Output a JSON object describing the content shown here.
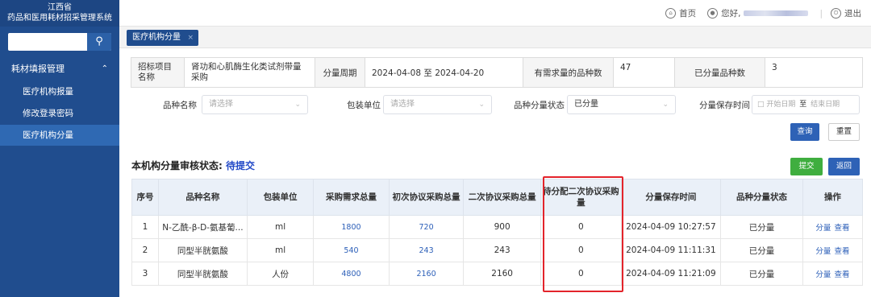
{
  "sidebar": {
    "logo_line1": "江西省",
    "logo_line2": "药品和医用耗材招采管理系统",
    "search_icon": "search-icon",
    "group_label": "耗材填报管理",
    "items": [
      {
        "label": "医疗机构报量"
      },
      {
        "label": "修改登录密码"
      },
      {
        "label": "医疗机构分量"
      }
    ]
  },
  "topbar": {
    "home": "首页",
    "greeting": "您好,",
    "logout": "退出"
  },
  "tab": {
    "label": "医疗机构分量",
    "close": "×"
  },
  "info": {
    "project_label": "招标项目名称",
    "project_value": "肾功和心肌酶生化类试剂带量采购",
    "period_label": "分量周期",
    "period_value": "2024-04-08 至 2024-04-20",
    "demand_count_label": "有需求量的品种数",
    "demand_count_value": "47",
    "allocated_count_label": "已分量品种数",
    "allocated_count_value": "3"
  },
  "filters": {
    "variety_label": "品种名称",
    "variety_placeholder": "请选择",
    "unit_label": "包装单位",
    "unit_placeholder": "请选择",
    "status_label": "品种分量状态",
    "status_value": "已分量",
    "save_time_label": "分量保存时间",
    "start_placeholder": "开始日期",
    "range_sep": "至",
    "end_placeholder": "结束日期"
  },
  "buttons": {
    "query": "查询",
    "reset": "重置",
    "submit": "提交",
    "back": "返回"
  },
  "status": {
    "prefix": "本机构分量审核状态:",
    "value": "待提交"
  },
  "table": {
    "headers": [
      "序号",
      "品种名称",
      "包装单位",
      "采购需求总量",
      "初次协议采购总量",
      "二次协议采购总量",
      "待分配二次协议采购量",
      "分量保存时间",
      "品种分量状态",
      "操作"
    ],
    "rows": [
      {
        "no": "1",
        "name": "N-乙酰-β-D-氨基葡...",
        "unit": "ml",
        "demand": "1800",
        "first": "720",
        "second": "900",
        "pending": "0",
        "time": "2024-04-09 10:27:57",
        "status": "已分量",
        "op1": "分量",
        "op2": "查看"
      },
      {
        "no": "2",
        "name": "同型半胱氨酸",
        "unit": "ml",
        "demand": "540",
        "first": "243",
        "second": "243",
        "pending": "0",
        "time": "2024-04-09 11:11:31",
        "status": "已分量",
        "op1": "分量",
        "op2": "查看"
      },
      {
        "no": "3",
        "name": "同型半胱氨酸",
        "unit": "人份",
        "demand": "4800",
        "first": "2160",
        "second": "2160",
        "pending": "0",
        "time": "2024-04-09 11:21:09",
        "status": "已分量",
        "op1": "分量",
        "op2": "查看"
      }
    ]
  },
  "colors": {
    "sidebar": "#204d8e",
    "accent": "#2e62b6",
    "highlight": "#e3242b",
    "submit": "#3fae3f"
  }
}
